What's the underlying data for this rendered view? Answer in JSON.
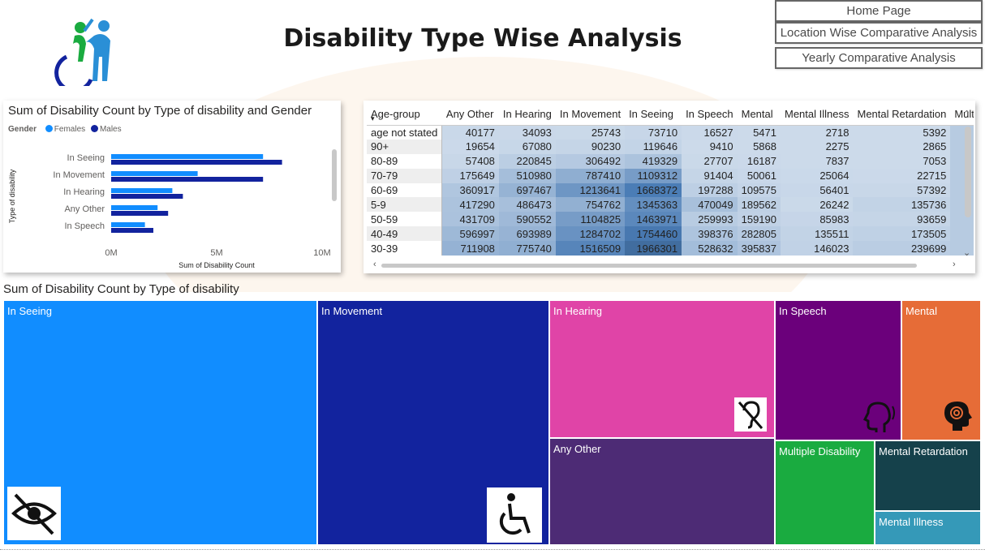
{
  "header": {
    "title": "Disability Type Wise Analysis"
  },
  "nav": {
    "home": "Home Page",
    "location": "Location Wise Comparative Analysis",
    "yearly": "Yearly Comparative Analysis"
  },
  "bar_chart": {
    "title": "Sum of Disability Count by Type of disability and Gender",
    "legend_title": "Gender",
    "legend": [
      {
        "name": "Females",
        "color": "#118dff"
      },
      {
        "name": "Males",
        "color": "#12239e"
      }
    ]
  },
  "chart_data": [
    {
      "type": "bar",
      "orientation": "horizontal",
      "title": "Sum of Disability Count by Type of disability and Gender",
      "categories": [
        "In Seeing",
        "In Movement",
        "In Hearing",
        "Any Other",
        "In Speech"
      ],
      "series": [
        {
          "name": "Females",
          "values": [
            7.2,
            4.1,
            2.9,
            2.2,
            1.6
          ]
        },
        {
          "name": "Males",
          "values": [
            8.1,
            7.2,
            3.4,
            2.7,
            2.0
          ]
        }
      ],
      "xlabel": "Sum of Disability Count",
      "ylabel": "Type of disability",
      "unit": "M",
      "xlim": [
        0,
        10
      ],
      "xticks": [
        "0M",
        "5M",
        "10M"
      ]
    },
    {
      "type": "treemap",
      "title": "Sum of Disability Count by Type of disability",
      "categories": [
        "In Seeing",
        "In Movement",
        "In Hearing",
        "Any Other",
        "In Speech",
        "Mental",
        "Multiple Disability",
        "Mental Retardation",
        "Mental Illness"
      ]
    }
  ],
  "matrix": {
    "columns": [
      "Age-group",
      "Any Other",
      "In Hearing",
      "In Movement",
      "In Seeing",
      "In Speech",
      "Mental",
      "Mental Illness",
      "Mental Retardation",
      "Multip"
    ],
    "rows": [
      {
        "label": "age not stated",
        "values": [
          "40177",
          "34093",
          "25743",
          "73710",
          "16527",
          "5471",
          "2718",
          "5392"
        ]
      },
      {
        "label": "90+",
        "values": [
          "19654",
          "67080",
          "90230",
          "119646",
          "9410",
          "5868",
          "2275",
          "2865"
        ]
      },
      {
        "label": "80-89",
        "values": [
          "57408",
          "220845",
          "306492",
          "419329",
          "27707",
          "16187",
          "7837",
          "7053"
        ]
      },
      {
        "label": "70-79",
        "values": [
          "175649",
          "510980",
          "787410",
          "1109312",
          "91404",
          "50061",
          "25064",
          "22715"
        ]
      },
      {
        "label": "60-69",
        "values": [
          "360917",
          "697467",
          "1213641",
          "1668372",
          "197288",
          "109575",
          "56401",
          "57392"
        ]
      },
      {
        "label": "5-9",
        "values": [
          "417290",
          "486473",
          "754762",
          "1345363",
          "470049",
          "189562",
          "26242",
          "135736"
        ]
      },
      {
        "label": "50-59",
        "values": [
          "431709",
          "590552",
          "1104825",
          "1463971",
          "259993",
          "159190",
          "85983",
          "93659"
        ]
      },
      {
        "label": "40-49",
        "values": [
          "596997",
          "693989",
          "1284702",
          "1754460",
          "398376",
          "282805",
          "135511",
          "173505"
        ]
      },
      {
        "label": "30-39",
        "values": [
          "711908",
          "775740",
          "1516509",
          "1966301",
          "528632",
          "395837",
          "146023",
          "239699"
        ]
      }
    ]
  },
  "treemap": {
    "title": "Sum of Disability Count by Type of disability",
    "tiles": [
      {
        "label": "In Seeing",
        "color": "#118dff",
        "icon": "eye-slash-icon"
      },
      {
        "label": "In Movement",
        "color": "#12239e",
        "icon": "wheelchair-icon"
      },
      {
        "label": "In Hearing",
        "color": "#e044a7",
        "icon": "ear-slash-icon"
      },
      {
        "label": "Any Other",
        "color": "#4d2b75",
        "icon": ""
      },
      {
        "label": "In Speech",
        "color": "#6b007b",
        "icon": "speaking-head-icon"
      },
      {
        "label": "Mental",
        "color": "#e66c37",
        "icon": "spiral-head-icon"
      },
      {
        "label": "Multiple Disability",
        "color": "#1aab40",
        "icon": ""
      },
      {
        "label": "Mental Retardation",
        "color": "#15414b",
        "icon": ""
      },
      {
        "label": "Mental Illness",
        "color": "#3599b8",
        "icon": ""
      }
    ]
  }
}
